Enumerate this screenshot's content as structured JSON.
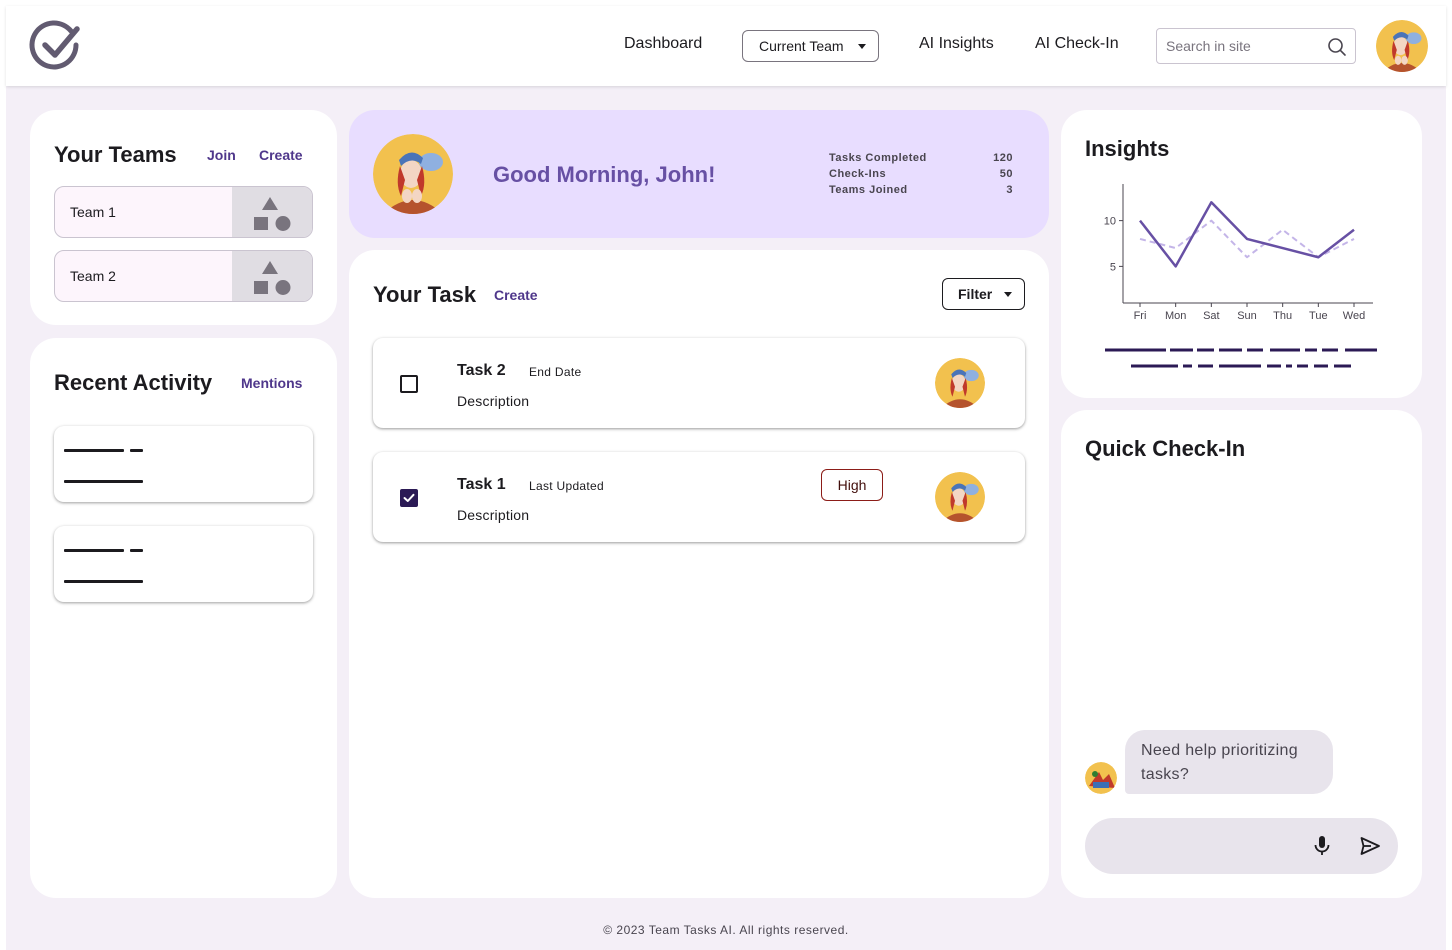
{
  "nav": {
    "dashboard": "Dashboard",
    "team_select": "Current Team",
    "ai_insights": "AI Insights",
    "ai_checkin": "AI Check-In",
    "search_placeholder": "Search in site"
  },
  "teams": {
    "title": "Your Teams",
    "join": "Join",
    "create": "Create",
    "items": [
      {
        "name": "Team 1"
      },
      {
        "name": "Team 2"
      }
    ]
  },
  "activity": {
    "title": "Recent Activity",
    "mentions": "Mentions"
  },
  "greeting": {
    "message": "Good Morning, John!",
    "stats": [
      {
        "label": "Tasks Completed",
        "value": "120"
      },
      {
        "label": "Check-Ins",
        "value": "50"
      },
      {
        "label": "Teams Joined",
        "value": "3"
      }
    ]
  },
  "tasks": {
    "title": "Your Task",
    "create": "Create",
    "filter": "Filter",
    "items": [
      {
        "title": "Task 2",
        "meta": "End Date",
        "description": "Description",
        "checked": false,
        "priority": ""
      },
      {
        "title": "Task 1",
        "meta": "Last Updated",
        "description": "Description",
        "checked": true,
        "priority": "High"
      }
    ]
  },
  "insights": {
    "title": "Insights"
  },
  "chart_data": {
    "type": "line",
    "title": "",
    "x": [
      "Fri",
      "Mon",
      "Sat",
      "Sun",
      "Thu",
      "Tue",
      "Wed"
    ],
    "series": [
      {
        "values": [
          10,
          5,
          12,
          8,
          7,
          6,
          9
        ],
        "style": "solid",
        "color": "#6750a4"
      },
      {
        "values": [
          8,
          7,
          10,
          6,
          9,
          6,
          8
        ],
        "style": "dashed",
        "color": "#c4b5e8"
      }
    ],
    "yticks": [
      5,
      10
    ],
    "ylim": [
      1,
      14
    ],
    "grid": false
  },
  "checkin": {
    "title": "Quick Check-In",
    "message": "Need help prioritizing tasks?",
    "input_placeholder": ""
  },
  "footer": "© 2023 Team Tasks AI. All rights reserved.",
  "icons": {
    "logo": "check-circle-icon",
    "search": "search-icon",
    "mic": "mic-icon",
    "send": "send-icon",
    "team_thumbnail": "shapes-icon"
  },
  "colors": {
    "accent": "#6750a4",
    "hero_bg": "#e8ddff",
    "page_bg": "#f4eff7",
    "priority": "#8c1d18"
  }
}
